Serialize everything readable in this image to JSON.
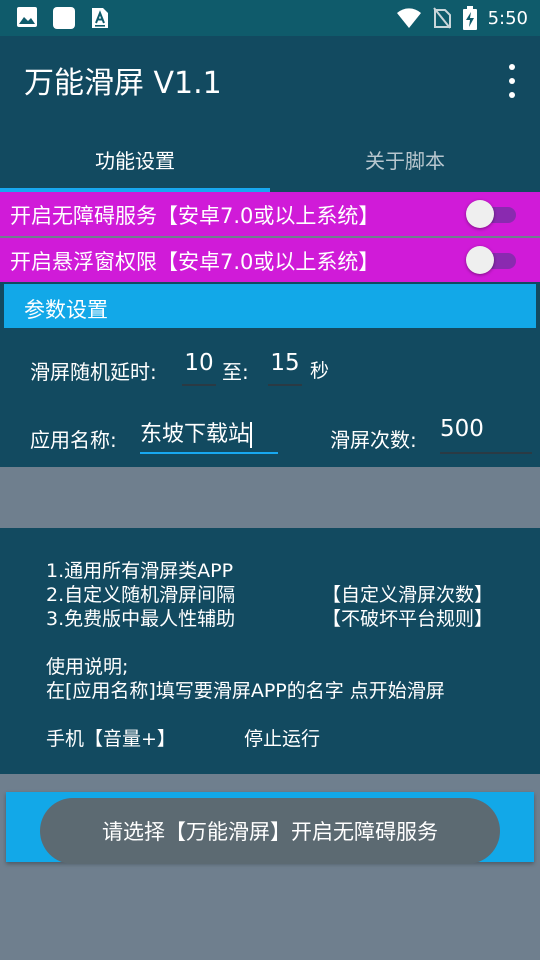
{
  "status_bar": {
    "time": "5:50",
    "icons": [
      "image-icon",
      "app-square-icon",
      "download-icon",
      "wifi-icon",
      "no-sim-icon",
      "battery-charging-icon"
    ]
  },
  "app_bar": {
    "title": "万能滑屏 V1.1",
    "menu_icon": "more-vert-icon"
  },
  "tabs": [
    {
      "label": "功能设置",
      "selected": true
    },
    {
      "label": "关于脚本",
      "selected": false
    }
  ],
  "permissions": [
    {
      "label": "开启无障碍服务【安卓7.0或以上系统】",
      "enabled": false
    },
    {
      "label": "开启悬浮窗权限【安卓7.0或以上系统】",
      "enabled": false
    }
  ],
  "params_header": "参数设置",
  "params": {
    "delay_label": "滑屏随机延时:",
    "delay_min": "10",
    "to_label": "至:",
    "delay_max": "15",
    "sec_label": "秒",
    "app_name_label": "应用名称:",
    "app_name": "东坡下载站",
    "count_label": "滑屏次数:",
    "count": "500"
  },
  "info": {
    "line1": "1.通用所有滑屏类APP",
    "line2": "2.自定义随机滑屏间隔",
    "line2_right": "【自定义滑屏次数】",
    "line3": "3.免费版中最人性辅助",
    "line3_right": "【不破坏平台规则】",
    "usage_title": "使用说明;",
    "usage_text": "在[应用名称]填写要滑屏APP的名字 点开始滑屏",
    "volume_label": "手机【音量+】",
    "stop_label": "停止运行"
  },
  "toast": "请选择【万能滑屏】开启无障碍服务",
  "colors": {
    "status_bar": "#0f5b6b",
    "app_bar": "#124a60",
    "accent": "#18a8f0",
    "permission_bg": "#d01bd8",
    "background": "#6f7f8e"
  }
}
